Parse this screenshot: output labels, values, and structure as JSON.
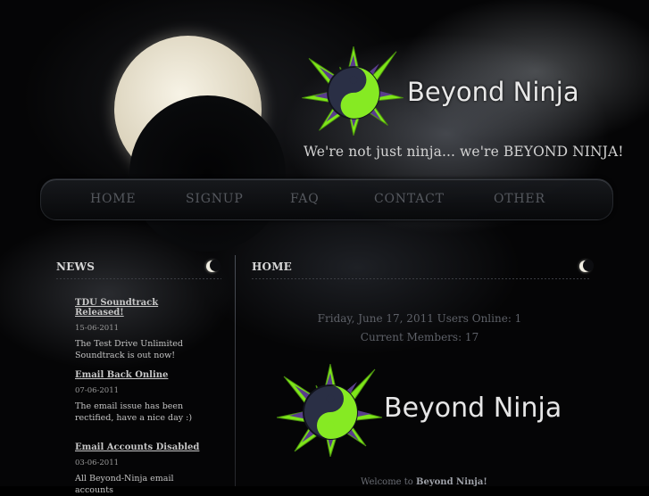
{
  "site": {
    "name": "Beyond Ninja",
    "tagline": "We're not just ninja... we're BEYOND NINJA!"
  },
  "nav": {
    "items": [
      "HOME",
      "SIGNUP",
      "FAQ",
      "CONTACT",
      "OTHER"
    ]
  },
  "sidebar": {
    "heading": "NEWS",
    "news": [
      {
        "title": "TDU Soundtrack Released!",
        "date": "15-06-2011",
        "body": "The Test Drive Unlimited Soundtrack is out now!"
      },
      {
        "title": "Email Back Online",
        "date": "07-06-2011",
        "body": "The email issue has been rectified, have a nice day :)"
      },
      {
        "title": "Email Accounts Disabled",
        "date": "03-06-2011",
        "body": "All Beyond-Ninja email accounts"
      }
    ]
  },
  "main": {
    "heading": "HOME",
    "status_line": "Friday, June 17, 2011 Users Online: 1",
    "members_line": "Current Members: 17",
    "logo_text": "Beyond Ninja",
    "welcome_prefix": "Welcome to",
    "welcome_name": "Beyond Ninja!"
  },
  "icons": {
    "logo": "yin-yang-ninja-star-icon",
    "section": "crescent-moon-icon"
  },
  "colors": {
    "accent_green": "#7ee619",
    "purple": "#5a3d8c",
    "nav_text": "#55585e"
  }
}
